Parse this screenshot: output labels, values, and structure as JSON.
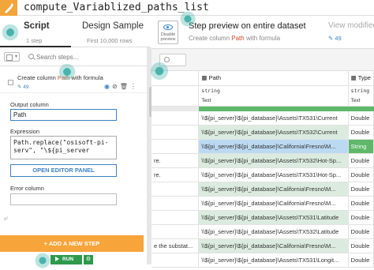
{
  "recipe": {
    "title": "compute_Variablized_paths_list"
  },
  "tabs": [
    {
      "label": "Script",
      "sub": "1 step"
    },
    {
      "label": "Design Sample",
      "sub": "First 10,000 rows"
    }
  ],
  "preview": {
    "disable_label": "Disable preview",
    "title": "Step preview on entire dataset",
    "sub_prefix": "Create column ",
    "sub_column": "Path",
    "sub_suffix": " with formula",
    "view_modified": "View modified",
    "col_count": "49"
  },
  "steps": {
    "search_placeholder": "Search steps...",
    "select_caret": "▾"
  },
  "step": {
    "title_prefix": "Create column ",
    "title_column": "Path",
    "title_suffix": " with formula",
    "count": "49",
    "output_label": "Output column",
    "output_value": "Path",
    "expression_label": "Expression",
    "expression_value": "Path.replace(\"osisoft-pi-serv\", \"\\${pi_server",
    "editor_button": "OPEN EDITOR PANEL",
    "error_label": "Error column",
    "error_value": "",
    "fx": "x²"
  },
  "actions": {
    "add_step": "+ ADD A NEW STEP",
    "run": "RUN",
    "run_more": "⚙"
  },
  "grid": {
    "columns": [
      {
        "name": "",
        "type": "",
        "meaning": ""
      },
      {
        "name": "Path",
        "type": "string",
        "meaning": "Text"
      },
      {
        "name": "Type",
        "type": "string",
        "meaning": "Text"
      }
    ],
    "rows": [
      {
        "c0": "",
        "c1": "\\\\${pi_server}\\${pi_database}\\Assets\\TX531\\Current",
        "c2": "Double"
      },
      {
        "c0": "",
        "c1": "\\\\${pi_server}\\${pi_database}\\Assets\\TX532\\Current",
        "c2": "Double"
      },
      {
        "c0": "",
        "c1": "\\\\${pi_server}\\${pi_database}\\California\\Fresno\\M...",
        "c2": "String"
      },
      {
        "c0": "re.",
        "c1": "\\\\${pi_server}\\${pi_database}\\Assets\\TX532\\Hot-Sp...",
        "c2": "Double"
      },
      {
        "c0": "re.",
        "c1": "\\\\${pi_server}\\${pi_database}\\Assets\\TX531\\Hot-Sp...",
        "c2": "Double"
      },
      {
        "c0": "",
        "c1": "\\\\${pi_server}\\${pi_database}\\California\\Fresno\\M...",
        "c2": "Double"
      },
      {
        "c0": "",
        "c1": "\\\\${pi_server}\\${pi_database}\\California\\Fresno\\M...",
        "c2": "Double"
      },
      {
        "c0": "",
        "c1": "\\\\${pi_server}\\${pi_database}\\Assets\\TX531\\Latitude",
        "c2": "Double"
      },
      {
        "c0": "",
        "c1": "\\\\${pi_server}\\${pi_database}\\Assets\\TX532\\Latitude",
        "c2": "Double"
      },
      {
        "c0": "e the substat...",
        "c1": "\\\\${pi_server}\\${pi_database}\\California\\Fresno\\M...",
        "c2": "Double"
      },
      {
        "c0": "",
        "c1": "\\\\${pi_server}\\${pi_database}\\Assets\\TX531\\Longit...",
        "c2": "Double"
      }
    ]
  },
  "colors": {
    "accent_orange": "#f7a43a",
    "accent_blue": "#3b82c4",
    "run_green": "#2e9a4b",
    "hotspot_teal": "#40b0a8"
  }
}
